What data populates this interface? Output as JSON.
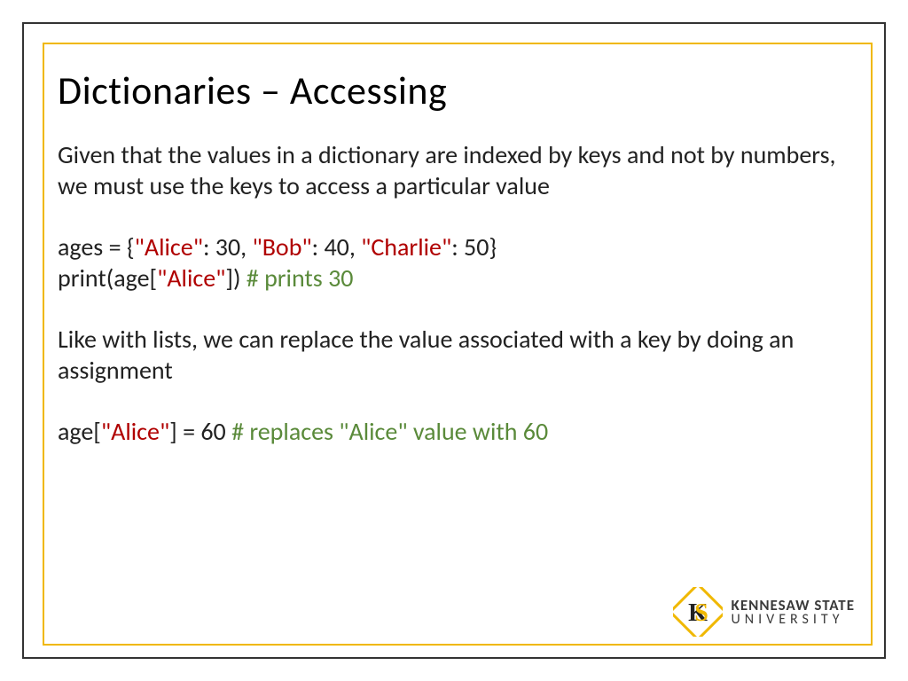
{
  "title": "Dictionaries – Accessing",
  "para1": "Given that the values in a dictionary are indexed by keys and not by numbers, we must use the keys to access a particular value",
  "code1": {
    "l1a": "ages = {",
    "l1b": "\"Alice\"",
    "l1c": ": 30, ",
    "l1d": "\"Bob\"",
    "l1e": ": 40, ",
    "l1f": "\"Charlie\"",
    "l1g": ": 50}",
    "l2a": "print(age[",
    "l2b": "\"Alice\"",
    "l2c": "]) ",
    "l2d": "# prints 30"
  },
  "para2": "Like with lists, we can replace the value associated with a key by doing an assignment",
  "code2": {
    "l1a": "age[",
    "l1b": "\"Alice\"",
    "l1c": "] = 60 ",
    "l1d": "# replaces \"Alice\" value with 60"
  },
  "logo": {
    "line1": "KENNESAW STATE",
    "line2": "UNIVERSITY"
  }
}
